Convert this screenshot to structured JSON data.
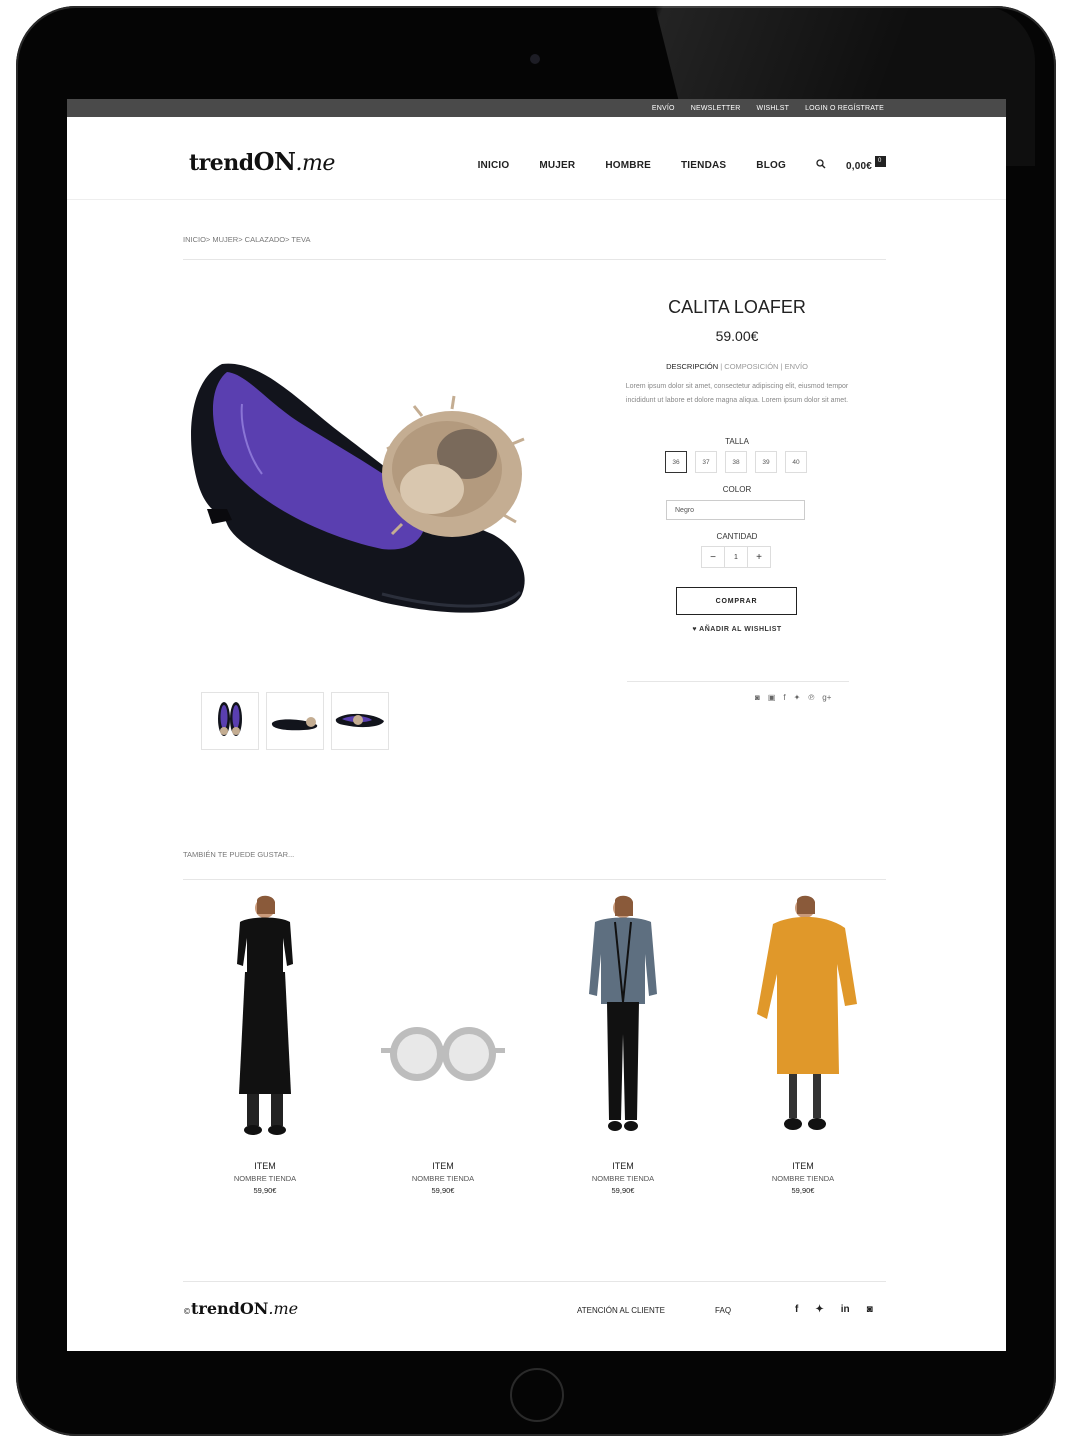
{
  "topbar": {
    "envio": "ENVÍO",
    "newsletter": "NEWSLETTER",
    "wishlist": "WISHLST",
    "login": "LOGIN O REGÍSTRATE"
  },
  "logo": {
    "trend": "trend",
    "on": "ON",
    "me": ".me"
  },
  "nav": {
    "inicio": "INICIO",
    "mujer": "MUJER",
    "hombre": "HOMBRE",
    "tiendas": "TIENDAS",
    "blog": "BLOG",
    "cart_total": "0,00€",
    "cart_count": "0"
  },
  "breadcrumb": "INICIO> MUJER> CALAZADO> TEVA",
  "product": {
    "name_bold": "CALITA",
    "name_light": " LOAFER",
    "price": "59.00€",
    "tab_descripcion": "DESCRIPCIÓN",
    "tab_composicion": "COMPOSICIÓN",
    "tab_envio": "ENVÍO",
    "tab_separator": " | ",
    "description": "Lorem ipsum dolor sit amet, consectetur adipiscing elit, eiusmod tempor incididunt ut labore et dolore magna aliqua. Lorem ipsum dolor sit amet.",
    "talla_label": "TALLA",
    "sizes": [
      "36",
      "37",
      "38",
      "39",
      "40"
    ],
    "color_label": "COLOR",
    "color_value": "Negro",
    "cantidad_label": "CANTIDAD",
    "qty_minus": "−",
    "qty_value": "1",
    "qty_plus": "+",
    "buy_label": "COMPRAR",
    "wishlist_label": "♥ AÑADIR AL WISHLIST"
  },
  "social_icons": [
    "instagram-icon",
    "youtube-icon",
    "facebook-icon",
    "twitter-icon",
    "pinterest-icon",
    "googleplus-icon"
  ],
  "social_glyphs": {
    "instagram": "◙",
    "youtube": "▣",
    "facebook": "f",
    "twitter": "✦",
    "pinterest": "℗",
    "googleplus": "g+"
  },
  "related": {
    "title": "TAMBIÉN TE PUEDE GUSTAR...",
    "items": [
      {
        "item": "ITEM",
        "store": "NOMBRE TIENDA",
        "price": "59,90€"
      },
      {
        "item": "ITEM",
        "store": "NOMBRE TIENDA",
        "price": "59,90€"
      },
      {
        "item": "ITEM",
        "store": "NOMBRE TIENDA",
        "price": "59,90€"
      },
      {
        "item": "ITEM",
        "store": "NOMBRE TIENDA",
        "price": "59,90€"
      }
    ]
  },
  "footer": {
    "copyright": "©",
    "atencion": "ATENCIÓN AL CLIENTE",
    "faq": "FAQ",
    "social": {
      "facebook": "f",
      "twitter": "✦",
      "linkedin": "in",
      "instagram": "◙"
    }
  },
  "colors": {
    "dark": "#222222",
    "topbar": "#4a4a4a",
    "shoe_lining": "#6b4fb8",
    "pompom": "#c8b39a"
  }
}
